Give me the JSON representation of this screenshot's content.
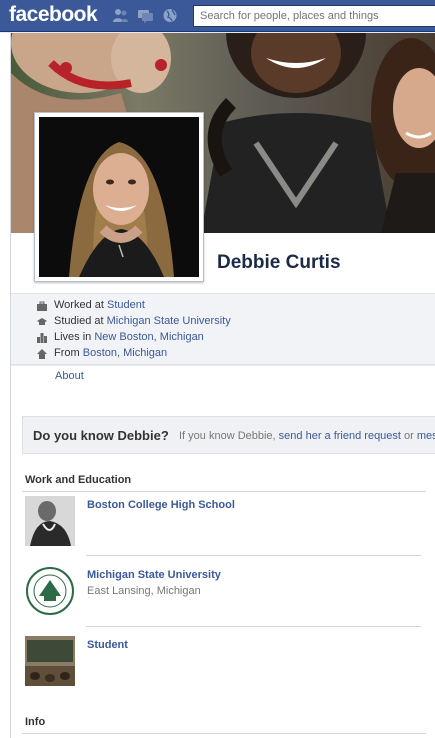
{
  "topbar": {
    "logo": "facebook",
    "search_placeholder": "Search for people, places and things",
    "icons": [
      "friends-icon",
      "messages-icon",
      "notifications-globe-icon"
    ]
  },
  "profile": {
    "name": "Debbie Curtis"
  },
  "info": {
    "worked": {
      "prefix": "Worked at ",
      "value": "Student",
      "icon": "briefcase-icon"
    },
    "studied": {
      "prefix": "Studied at ",
      "value": "Michigan State University",
      "icon": "graduation-cap-icon"
    },
    "lives": {
      "prefix": "Lives in ",
      "value": "New Boston, Michigan",
      "icon": "city-icon"
    },
    "from": {
      "prefix": "From ",
      "value": "Boston, Michigan",
      "icon": "home-icon"
    }
  },
  "about_link": "About",
  "know_box": {
    "question": "Do you know Debbie?",
    "sub_prefix": "If you know Debbie, ",
    "sub_link": "send her a friend request",
    "sub_suffix": " or ",
    "sub_more": "mes"
  },
  "work_education": {
    "title": "Work and Education",
    "items": [
      {
        "name": "Boston College High School",
        "location": ""
      },
      {
        "name": "Michigan State University",
        "location": "East Lansing, Michigan"
      },
      {
        "name": "Student",
        "location": ""
      }
    ]
  },
  "info_section": {
    "title": "Info"
  },
  "colors": {
    "brand_blue": "#3b5998",
    "link": "#3b5998",
    "name": "#1c2a47"
  }
}
